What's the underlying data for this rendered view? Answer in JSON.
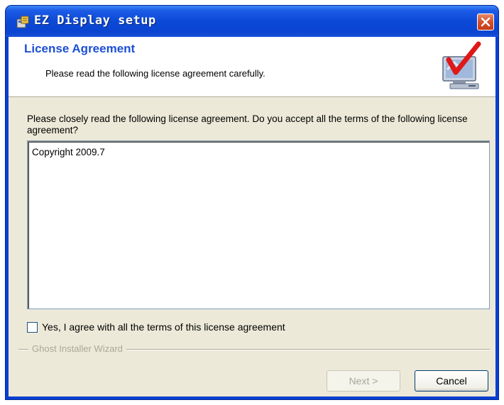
{
  "window": {
    "title": "EZ Display setup"
  },
  "header": {
    "title": "License Agreement",
    "subtitle": "Please read the following license agreement carefully."
  },
  "main": {
    "instruction": "Please closely read the following license agreement. Do you accept all the terms of the following license agreement?",
    "license_text": "Copyright 2009.7",
    "agree_label": "Yes, I agree with all the terms of this license agreement",
    "agree_checked": false,
    "group_label": "Ghost Installer Wizard"
  },
  "buttons": {
    "next_label": "Next >",
    "next_enabled": false,
    "cancel_label": "Cancel"
  },
  "icons": {
    "app": "installer-app-icon",
    "close": "close-icon",
    "header": "computer-checkmark-icon"
  },
  "colors": {
    "titlebar": "#0a44d0",
    "header_title": "#1c4ed6",
    "dialog_bg": "#ece9d8",
    "close_button": "#d4502c"
  }
}
